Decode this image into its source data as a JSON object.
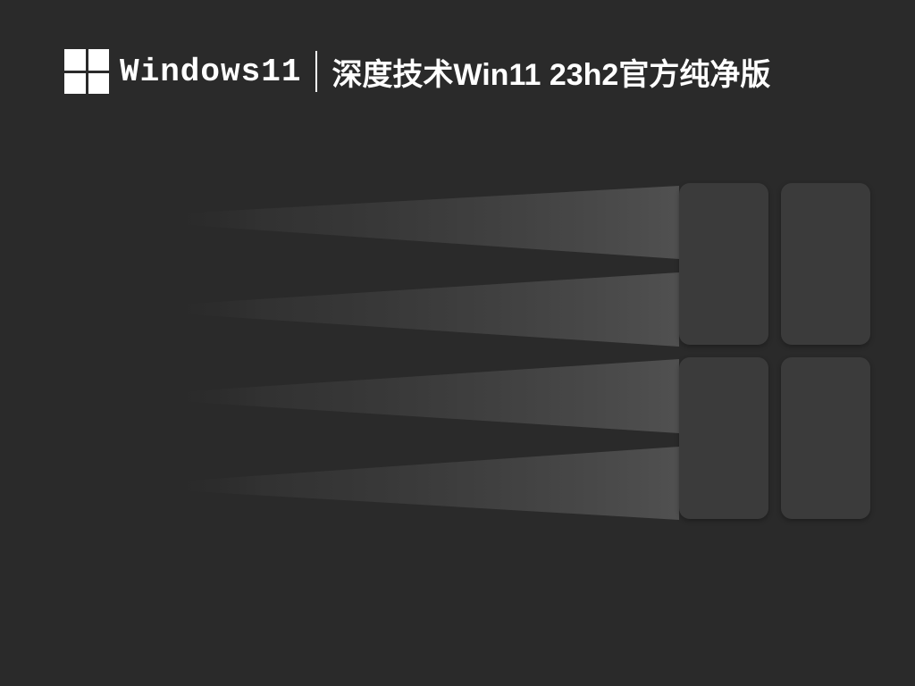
{
  "header": {
    "brand": "Windows11",
    "title": "深度技术Win11 23h2官方纯净版"
  }
}
